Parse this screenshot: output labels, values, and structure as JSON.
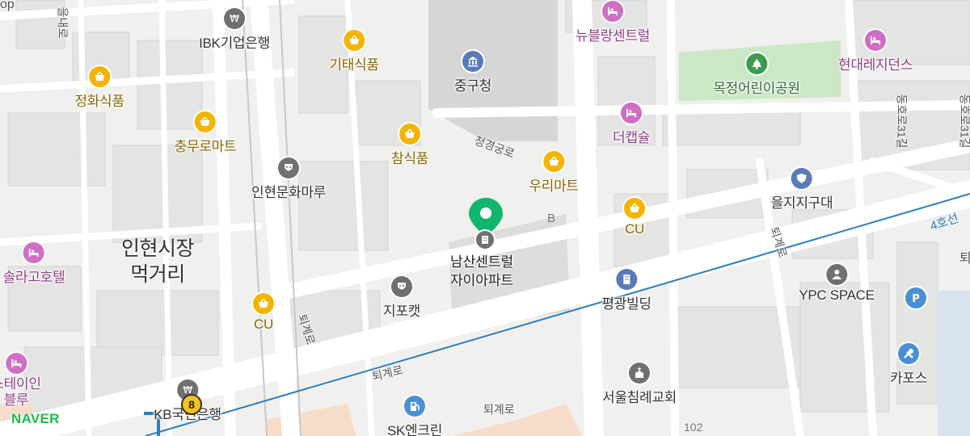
{
  "map": {
    "brand": "NAVER",
    "pins": [
      {
        "name": "남산센트럴 자이아파트",
        "line1": "남산센트럴",
        "line2": "자이아파트"
      }
    ],
    "areas": [
      {
        "line1": "인현시장",
        "line2": "먹거리"
      }
    ],
    "pois": [
      {
        "key": "ibk",
        "label": "IBK기업은행",
        "type": "bank",
        "color": "gray"
      },
      {
        "key": "gitae",
        "label": "기태식품",
        "type": "store",
        "color": "yellow"
      },
      {
        "key": "junggu",
        "label": "중구청",
        "type": "government",
        "color": "blue"
      },
      {
        "key": "newblang",
        "label": "뉴블랑센트럴",
        "type": "hotel",
        "color": "purple"
      },
      {
        "key": "hyundai",
        "label": "현대레지던스",
        "type": "hotel",
        "color": "purple"
      },
      {
        "key": "mokjeong",
        "label": "목정어린이공원",
        "type": "park",
        "color": "green"
      },
      {
        "key": "junghwa",
        "label": "정화식품",
        "type": "store",
        "color": "yellow"
      },
      {
        "key": "chungmuro",
        "label": "충무로마트",
        "type": "store",
        "color": "yellow"
      },
      {
        "key": "cham",
        "label": "참식품",
        "type": "store",
        "color": "yellow"
      },
      {
        "key": "thecapsule",
        "label": "더캡슐",
        "type": "hotel",
        "color": "purple"
      },
      {
        "key": "woori",
        "label": "우리마트",
        "type": "store",
        "color": "yellow"
      },
      {
        "key": "euljiji",
        "label": "을지지구대",
        "type": "police",
        "color": "blue"
      },
      {
        "key": "inhyeon",
        "label": "인현문화마루",
        "type": "culture",
        "color": "gray"
      },
      {
        "key": "cu1",
        "label": "CU",
        "type": "store",
        "color": "yellow"
      },
      {
        "key": "solla",
        "label": "솔라고호텔",
        "type": "hotel",
        "color": "purple"
      },
      {
        "key": "jipo",
        "label": "지포캣",
        "type": "culture",
        "color": "gray"
      },
      {
        "key": "pyeonggwang",
        "label": "평광빌딩",
        "type": "building",
        "color": "blue"
      },
      {
        "key": "ypc",
        "label": "YPC SPACE",
        "type": "culture",
        "color": "gray"
      },
      {
        "key": "parking",
        "label": "",
        "type": "parking",
        "color": "blue"
      },
      {
        "key": "cu2",
        "label": "CU",
        "type": "store",
        "color": "yellow"
      },
      {
        "key": "stein",
        "label": "스테이인",
        "line2": "블루",
        "type": "hotel",
        "color": "purple"
      },
      {
        "key": "kb",
        "label": "KB국민은행",
        "type": "bank",
        "color": "gray"
      },
      {
        "key": "sk",
        "label": "SK엔크린",
        "type": "gas",
        "color": "blue"
      },
      {
        "key": "seoulchimrye",
        "label": "서울침례교회",
        "type": "church",
        "color": "gray"
      },
      {
        "key": "capos",
        "label": "카포스",
        "type": "repair",
        "color": "blue"
      }
    ],
    "roads": [
      {
        "key": "toegye_main",
        "label": "퇴계로"
      },
      {
        "key": "toegye_a",
        "label": "퇴계로"
      },
      {
        "key": "toegye_b",
        "label": "퇴계로"
      },
      {
        "key": "toegye_c",
        "label": "퇴계로"
      },
      {
        "key": "cheonggyeong",
        "label": "청경궁로"
      },
      {
        "key": "dongho",
        "label": "동호로31길"
      },
      {
        "key": "dongho2",
        "label": "동호로31길"
      },
      {
        "key": "topleft",
        "label": "을내로"
      }
    ],
    "subway": {
      "line": "4호선",
      "color": "#2e7fbd"
    },
    "route_badge": "8",
    "building_labels": [
      "B",
      "102"
    ],
    "edge_text": {
      "left_top": "op",
      "right_edge": "퇴"
    }
  }
}
